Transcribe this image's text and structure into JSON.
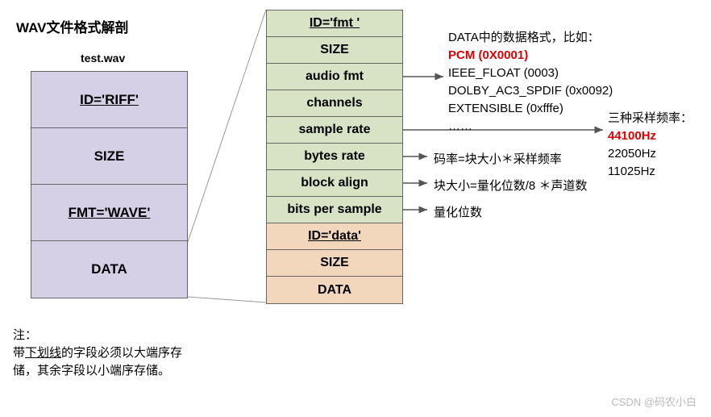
{
  "title": "WAV文件格式解剖",
  "filename": "test.wav",
  "left": {
    "id_riff": "ID='RIFF'",
    "size": "SIZE",
    "fmt_wave": "FMT='WAVE'",
    "data": "DATA"
  },
  "mid": {
    "id_fmt": "ID='fmt '",
    "size1": "SIZE",
    "audio_fmt": "audio fmt",
    "channels": "channels",
    "sample_rate": "sample rate",
    "bytes_rate": "bytes rate",
    "block_align": "block align",
    "bits_per_sample": "bits per sample",
    "id_data": "ID='data'",
    "size2": "SIZE",
    "data": "DATA"
  },
  "formats": {
    "header": "DATA中的数据格式，比如：",
    "pcm": "PCM (0X0001)",
    "ieee": "IEEE_FLOAT (0003)",
    "dolby": "DOLBY_AC3_SPDIF (0x0092)",
    "ext": "EXTENSIBLE (0xfffe)",
    "more": "……"
  },
  "sample_rates": {
    "header": "三种采样频率：",
    "r1": "44100Hz",
    "r2": "22050Hz",
    "r3": "11025Hz"
  },
  "annotations": {
    "bytes_rate": "码率=块大小＊采样频率",
    "block_align": "块大小=量化位数/8 ＊声道数",
    "bits": "量化位数"
  },
  "note": {
    "l1": "注：",
    "l2a": "带",
    "l2b": "下划线",
    "l2c": "的字段必须以大端序存储，其余字段以小端序存储。"
  },
  "watermark": "CSDN @码农小白"
}
